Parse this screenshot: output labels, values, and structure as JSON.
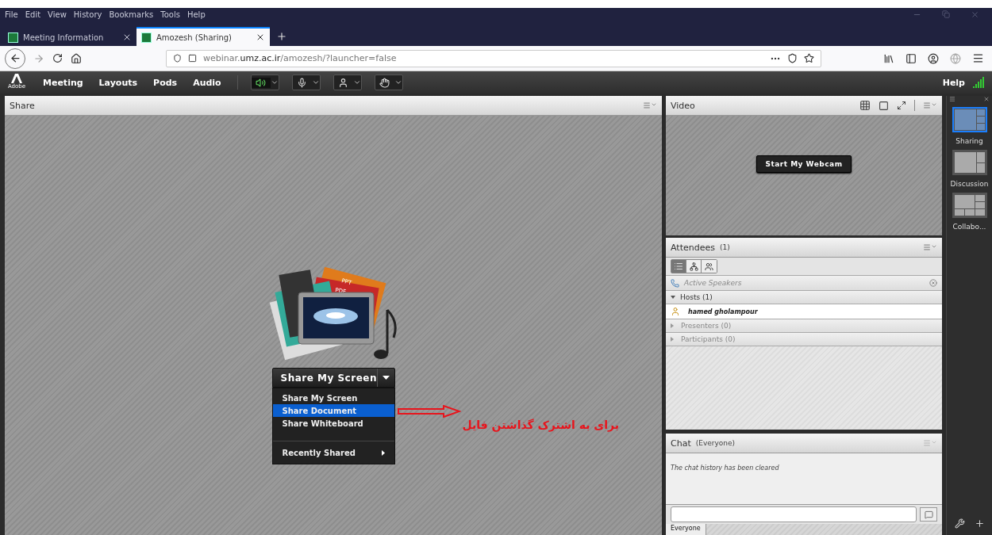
{
  "browser": {
    "menu": [
      "File",
      "Edit",
      "View",
      "History",
      "Bookmarks",
      "Tools",
      "Help"
    ],
    "tabs": [
      {
        "title": "Meeting Information",
        "selected": false
      },
      {
        "title": "Amozesh (Sharing)",
        "selected": true
      }
    ],
    "url": "webinar.**umz.ac.ir**/amozesh/?launcher=false"
  },
  "toolbar": {
    "logo": "Adobe",
    "menus": [
      "Meeting",
      "Layouts",
      "Pods",
      "Audio"
    ],
    "speaker_on": true,
    "help": "Help"
  },
  "share_pod": {
    "title": "Share",
    "artwork_labels": [
      "PPT",
      "PDF"
    ],
    "button": "Share My Screen",
    "menu": [
      {
        "label": "Share My Screen",
        "selected": false
      },
      {
        "label": "Share Document",
        "selected": true
      },
      {
        "label": "Share Whiteboard",
        "selected": false
      }
    ],
    "recent": "Recently Shared",
    "annotation": "برای به اشترک گذاشتن فایل"
  },
  "video_pod": {
    "title": "Video",
    "button": "Start My Webcam"
  },
  "attendees_pod": {
    "title": "Attendees",
    "count": "(1)",
    "active_speakers": "Active Speakers",
    "groups": [
      {
        "label": "Hosts (1)",
        "expanded": true,
        "children": [
          {
            "name": "hamed gholampour"
          }
        ]
      },
      {
        "label": "Presenters (0)",
        "expanded": false
      },
      {
        "label": "Participants (0)",
        "expanded": false
      }
    ]
  },
  "chat_pod": {
    "title": "Chat",
    "scope": "(Everyone)",
    "message": "The chat history has been cleared",
    "tab": "Everyone"
  },
  "layouts": [
    {
      "label": "Sharing",
      "kind": "sharing",
      "selected": true
    },
    {
      "label": "Discussion",
      "kind": "discussion",
      "selected": false
    },
    {
      "label": "Collabo...",
      "kind": "collaboration",
      "selected": false
    }
  ]
}
